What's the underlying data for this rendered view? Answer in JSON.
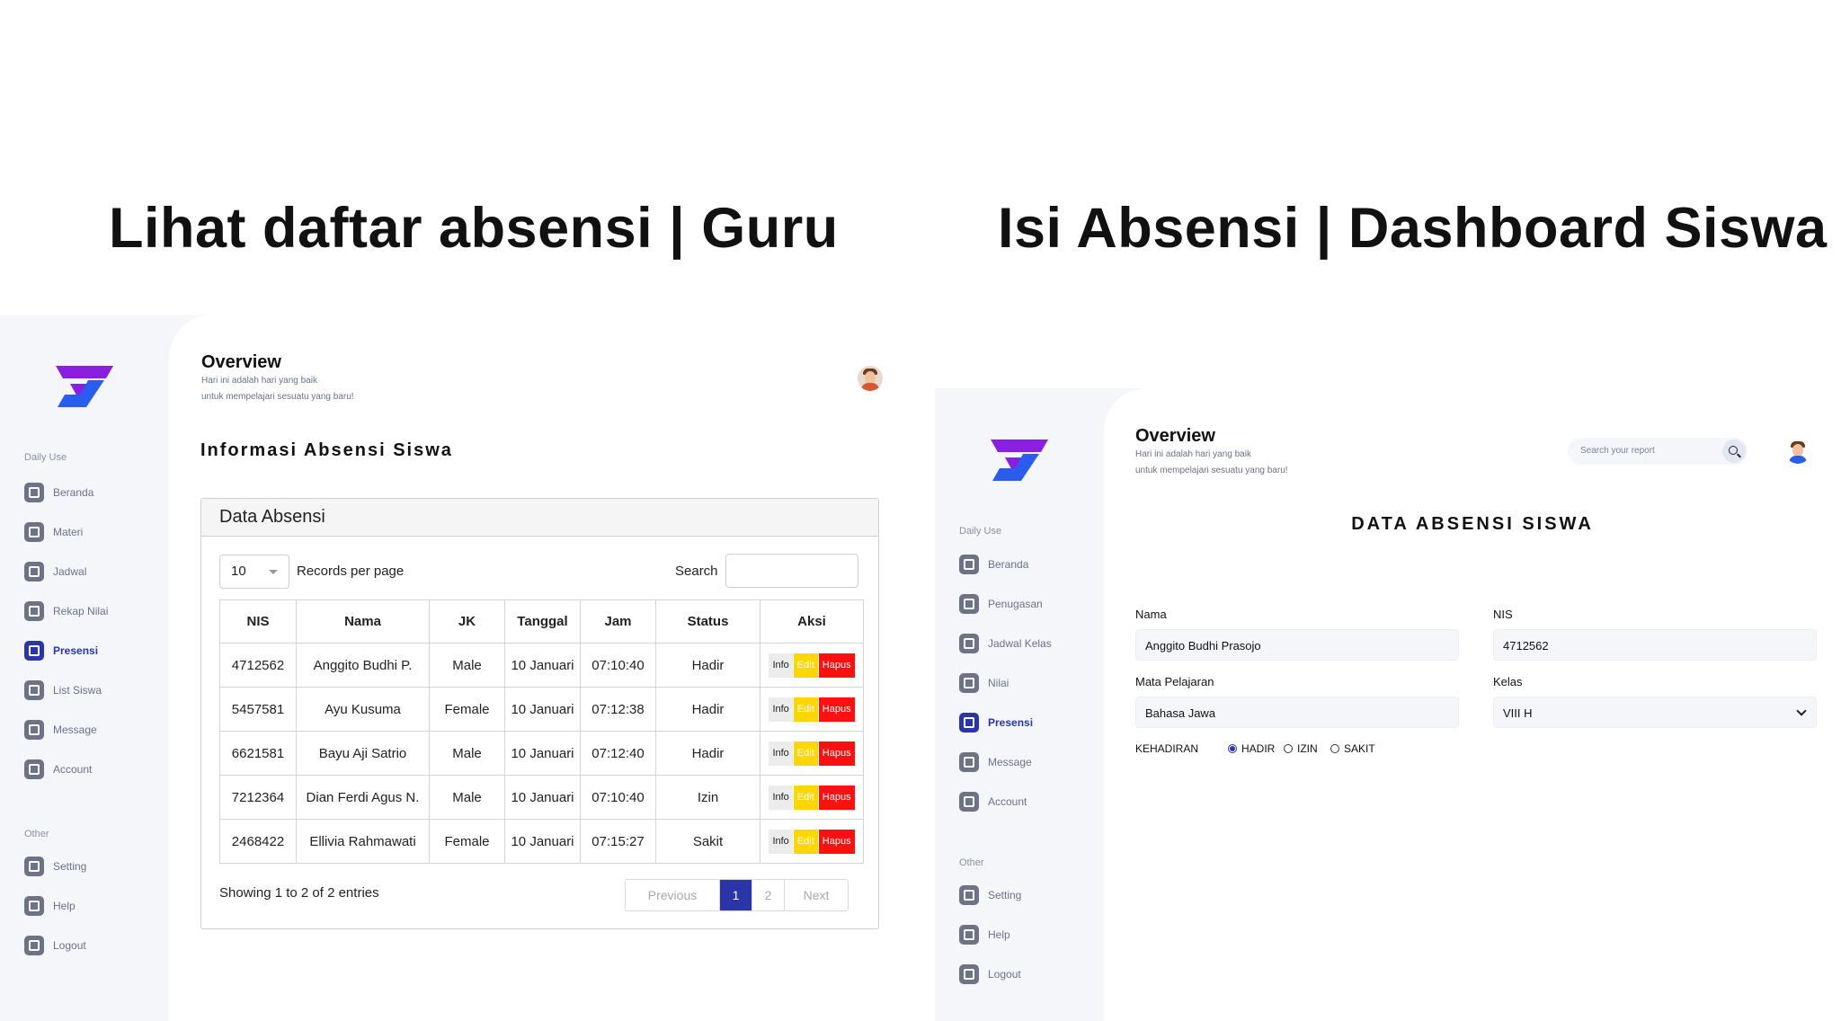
{
  "headings": {
    "left": "Lihat daftar absensi | Guru",
    "right": "Isi Absensi | Dashboard Siswa"
  },
  "sidebar_left": {
    "section_daily": "Daily Use",
    "section_other": "Other",
    "items": [
      "Beranda",
      "Materi",
      "Jadwal",
      "Rekap Nilai",
      "Presensi",
      "List Siswa",
      "Message",
      "Account"
    ],
    "active": "Presensi",
    "other_items": [
      "Setting",
      "Help",
      "Logout"
    ]
  },
  "sidebar_right": {
    "section_daily": "Daily Use",
    "section_other": "Other",
    "items": [
      "Beranda",
      "Penugasan",
      "Jadwal Kelas",
      "Nilai",
      "Presensi",
      "Message",
      "Account"
    ],
    "active": "Presensi",
    "other_items": [
      "Setting",
      "Help",
      "Logout"
    ]
  },
  "overview": {
    "title": "Overview",
    "line1": "Hari ini adalah hari yang baik",
    "line2": "untuk mempelajari sesuatu yang baru!"
  },
  "teacher": {
    "section_title": "Informasi Absensi Siswa",
    "card_title": "Data Absensi",
    "records_value": "10",
    "records_label": "Records per page",
    "search_label": "Search",
    "columns": [
      "NIS",
      "Nama",
      "JK",
      "Tanggal",
      "Jam",
      "Status",
      "Aksi"
    ],
    "rows": [
      [
        "4712562",
        "Anggito Budhi P.",
        "Male",
        "10 Januari",
        "07:10:40",
        "Hadir"
      ],
      [
        "5457581",
        "Ayu Kusuma",
        "Female",
        "10 Januari",
        "07:12:38",
        "Hadir"
      ],
      [
        "6621581",
        "Bayu Aji Satrio",
        "Male",
        "10 Januari",
        "07:12:40",
        "Hadir"
      ],
      [
        "7212364",
        "Dian Ferdi Agus N.",
        "Male",
        "10 Januari",
        "07:10:40",
        "Izin"
      ],
      [
        "2468422",
        "Ellivia Rahmawati",
        "Female",
        "10 Januari",
        "07:15:27",
        "Sakit"
      ]
    ],
    "actions": [
      "Info",
      "Edit",
      "Hapus"
    ],
    "showing": "Showing 1 to 2 of 2 entries",
    "pager": [
      "Previous",
      "1",
      "2",
      "Next"
    ]
  },
  "student": {
    "search_placeholder": "Search your report",
    "form_title": "DATA ABSENSI SISWA",
    "nama_label": "Nama",
    "nama_value": "Anggito Budhi Prasojo",
    "nis_label": "NIS",
    "nis_value": "4712562",
    "mapel_label": "Mata Pelajaran",
    "mapel_value": "Bahasa Jawa",
    "kelas_label": "Kelas",
    "kelas_value": "VIII H",
    "kehadiran_label": "KEHADIRAN",
    "options": [
      "HADIR",
      "IZIN",
      "SAKIT"
    ],
    "selected": "HADIR"
  },
  "colors": {
    "accent": "#2a36a8",
    "edit": "#ffd600",
    "hapus": "#ff1010",
    "logo_top": "#8a1fe0",
    "logo_bottom": "#2a5cf0"
  }
}
